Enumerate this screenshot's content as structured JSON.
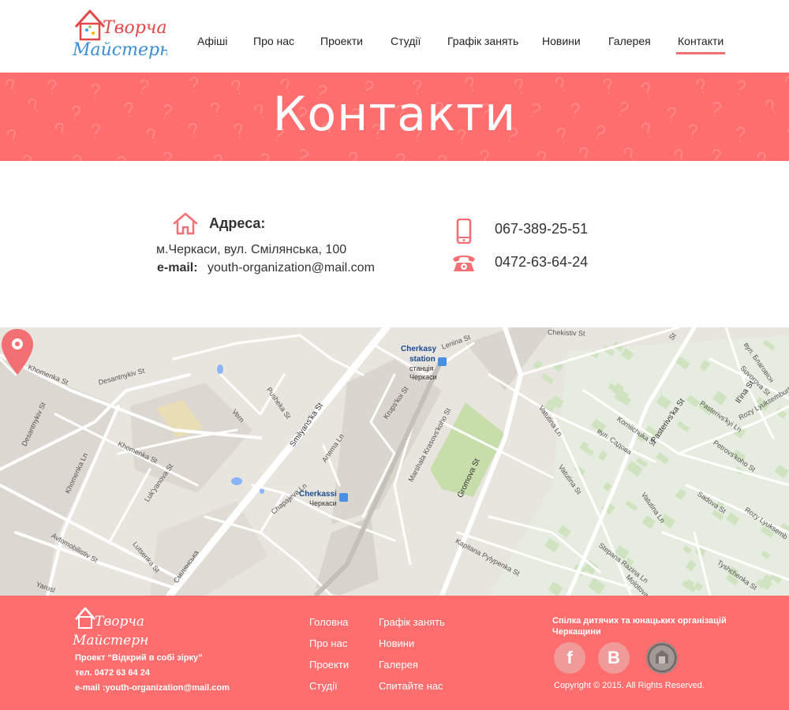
{
  "header": {
    "logo": {
      "line1": "Творча",
      "line2": "Майстерня"
    },
    "nav": [
      {
        "label": "Афіші"
      },
      {
        "label": "Про нас"
      },
      {
        "label": "Проекти"
      },
      {
        "label": "Студії"
      },
      {
        "label": "Графік занять"
      },
      {
        "label": "Новини"
      },
      {
        "label": "Галерея"
      },
      {
        "label": "Контакти",
        "active": true
      }
    ]
  },
  "banner": {
    "title": "Контакти"
  },
  "contacts": {
    "address_label": "Адреса:",
    "address": "м.Черкаси, вул. Смілянська, 100",
    "email_label": "e-mail:",
    "email": "youth-organization@mail.com",
    "phone_mobile": "067-389-25-51",
    "phone_landline": "0472-63-64-24"
  },
  "map": {
    "labels": [
      "Chekistiv St",
      "Cherkasy",
      "station",
      "станція",
      "Черкаси",
      "Lenina St",
      "Khomenka St",
      "Desantnykiv St",
      "Desantnykiv St",
      "Pusheka St",
      "Smilyans'ka St",
      "Khomenka Ln",
      "Khomenka St",
      "Luk'yanova St",
      "Artema Ln",
      "Krups'koi St",
      "Marshala Krasovs'koho St",
      "Gromova St",
      "Vatutina Ln",
      "Vatutina St",
      "Vatutina Ln",
      "Korniichuka St",
      "вул. Садова",
      "Pasterivs'ka St",
      "Pasterivs'kyi Ln",
      "Il'ina St",
      "Suvorova St",
      "Petrovs'koho St",
      "Rozy Lyuksemburh St",
      "Sadova St",
      "Rozy Lyuksemb",
      "Cherkassi",
      "Черкаси",
      "Chapajeva Ln",
      "Avtomobilistiv St",
      "Lutsenka St",
      "Kapitana Pylypenka St",
      "Stepana Razina Ln",
      "Molotova",
      "Tyshchenka St",
      "Yarosl",
      "Смілянська",
      "вул. Благовісн",
      "Vern",
      "St"
    ]
  },
  "footer": {
    "logo": {
      "line1": "Творча",
      "line2": "Майстерня"
    },
    "project": "Проект “Відкрий в собі зірку”",
    "phone": "тел. 0472 63 64 24",
    "email": "e-mail :youth-organization@mail.com",
    "links_col1": [
      "Головна",
      "Про нас",
      "Проекти",
      "Студії"
    ],
    "links_col2": [
      "Графік занять",
      "Новини",
      "Галерея",
      "Спитайте нас"
    ],
    "org": "Спілка дитячих та юнацьких організацій Черкащини",
    "social": [
      {
        "icon": "facebook-icon",
        "glyph": "f"
      },
      {
        "icon": "vkontakte-icon",
        "glyph": "B"
      },
      {
        "icon": "emblem-icon",
        "glyph": ""
      }
    ],
    "copyright": "Copyright © 2015.  All Rights Reserved."
  },
  "colors": {
    "accent": "#ff6e6e",
    "accent_dark": "#f26f73",
    "text": "#333333"
  }
}
